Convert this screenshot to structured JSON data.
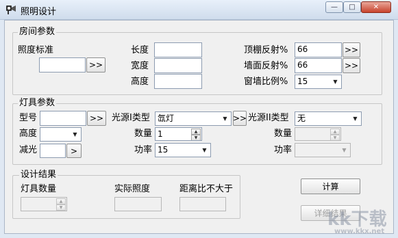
{
  "window": {
    "title": "照明设计",
    "minimize": "—",
    "maximize": "□",
    "close": "✕"
  },
  "room": {
    "group_title": "房间参数",
    "illum_label": "照度标准",
    "illum_value": "",
    "illum_btn": ">>",
    "length_label": "长度",
    "length_value": "",
    "width_label": "宽度",
    "width_value": "",
    "height_label": "高度",
    "height_value": "",
    "ceiling_label": "顶棚反射%",
    "ceiling_value": "66",
    "ceiling_btn": ">>",
    "wall_label": "墙面反射%",
    "wall_value": "66",
    "wall_btn": ">>",
    "window_label": "窗墙比例%",
    "window_value": "15"
  },
  "fixture": {
    "group_title": "灯具参数",
    "model_label": "型号",
    "model_value": "",
    "model_btn": ">>",
    "height_label": "高度",
    "height_value": "",
    "dim_label": "减光",
    "dim_value": "",
    "dim_btn": ">",
    "src1_label": "光源I类型",
    "src1_value": "氙灯",
    "src1_btn": ">>",
    "qty1_label": "数量",
    "qty1_value": "1",
    "power1_label": "功率",
    "power1_value": "15",
    "src2_label": "光源II类型",
    "src2_value": "无",
    "qty2_label": "数量",
    "qty2_value": "",
    "power2_label": "功率",
    "power2_value": ""
  },
  "result": {
    "group_title": "设计结果",
    "count_label": "灯具数量",
    "count_value": "",
    "actual_label": "实际照度",
    "actual_value": "",
    "ratio_label": "距离比不大于",
    "ratio_value": ""
  },
  "actions": {
    "compute": "计算",
    "details": "详细结果"
  },
  "watermark": {
    "text": "kk下载",
    "url": "www.kkx.net"
  }
}
